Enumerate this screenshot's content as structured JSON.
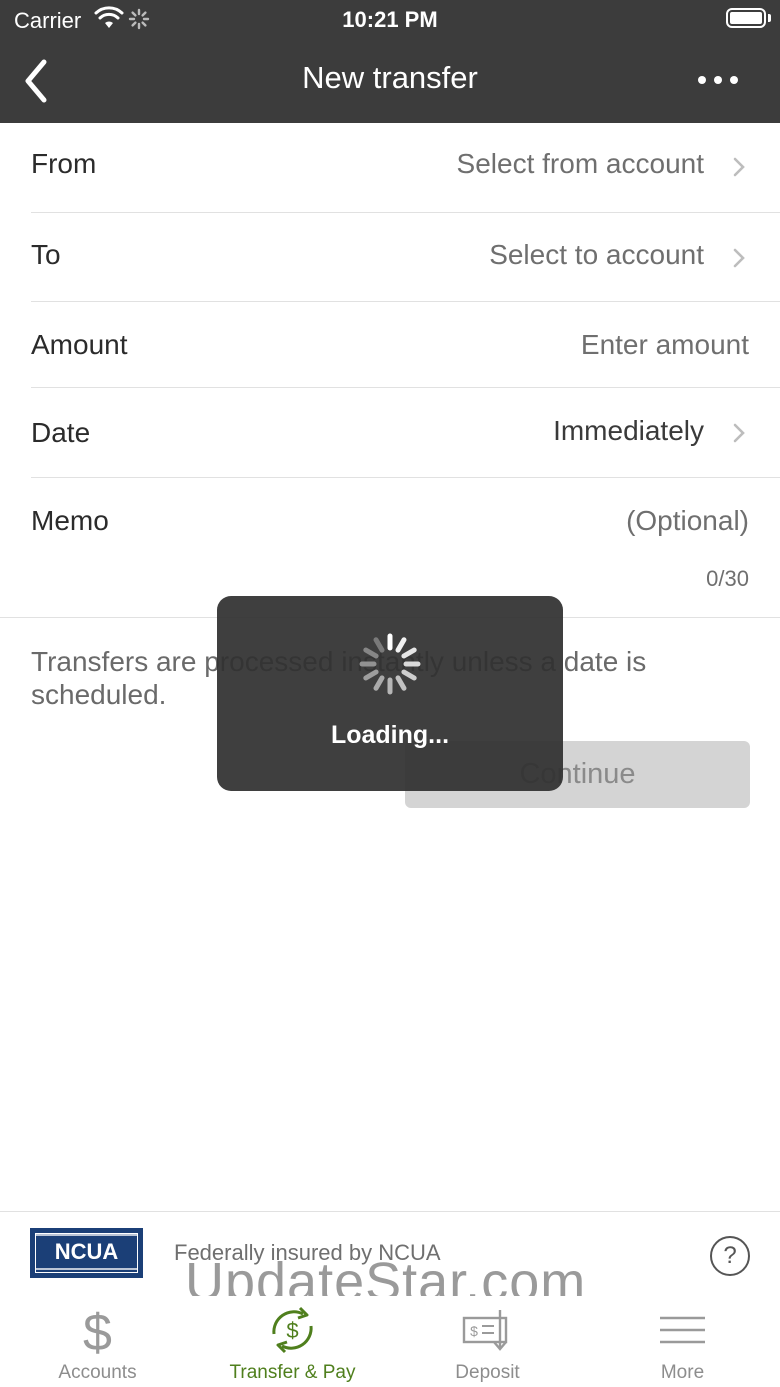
{
  "status_bar": {
    "carrier": "Carrier",
    "time": "10:21 PM"
  },
  "nav": {
    "title": "New transfer"
  },
  "form": {
    "from": {
      "label": "From",
      "value": "Select from account"
    },
    "to": {
      "label": "To",
      "value": "Select to account"
    },
    "amount": {
      "label": "Amount",
      "placeholder": "Enter amount"
    },
    "date": {
      "label": "Date",
      "value": "Immediately"
    },
    "memo": {
      "label": "Memo",
      "placeholder": "(Optional)",
      "counter": "0/30"
    }
  },
  "info_text": "Transfers are processed instantly unless a date is scheduled.",
  "continue_label": "Continue",
  "loading": {
    "text": "Loading..."
  },
  "insurance": {
    "logo_text": "NCUA",
    "text": "Federally insured by NCUA",
    "help": "?"
  },
  "watermark": "UpdateStar.com",
  "tabs": [
    {
      "label": "Accounts",
      "icon": "dollar-icon"
    },
    {
      "label": "Transfer & Pay",
      "icon": "transfer-pay-icon",
      "active": true
    },
    {
      "label": "Deposit",
      "icon": "deposit-check-icon"
    },
    {
      "label": "More",
      "icon": "hamburger-icon"
    }
  ],
  "colors": {
    "header": "#3c3c3c",
    "active_tab": "#4f7f1d",
    "ncua_blue": "#1b3f77"
  }
}
